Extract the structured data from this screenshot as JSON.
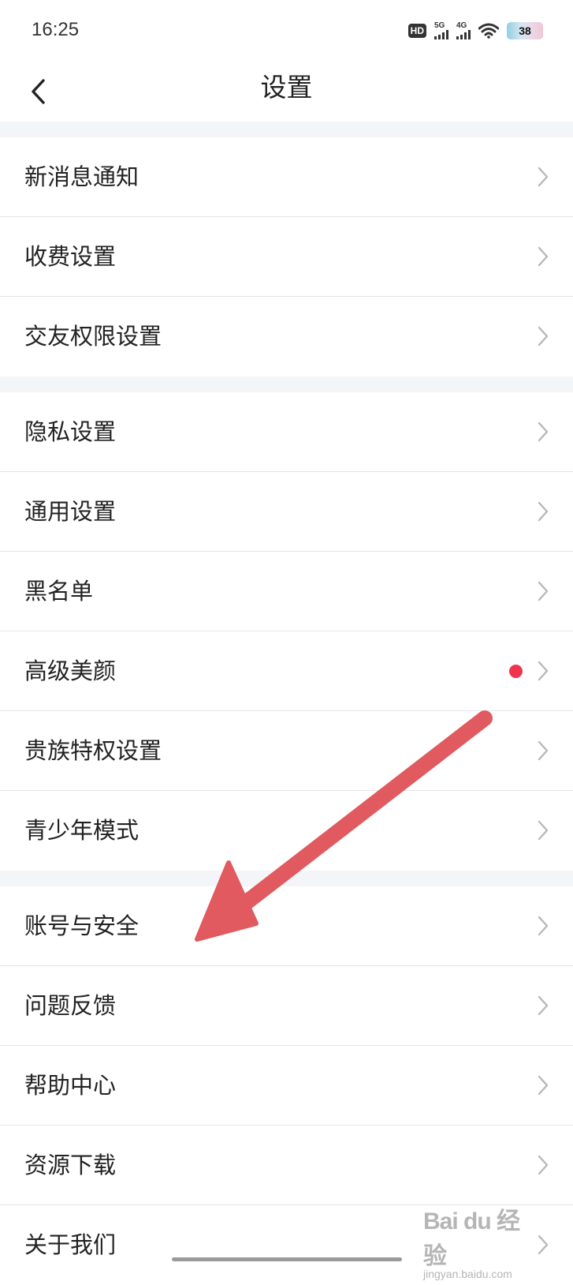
{
  "status_bar": {
    "time": "16:25",
    "hd_label": "HD",
    "sim1_network": "5G",
    "sim2_network": "4G",
    "battery_level": "38"
  },
  "nav": {
    "title": "设置",
    "back_icon": "chevron-left-icon"
  },
  "groups": [
    {
      "items": [
        {
          "label": "新消息通知"
        },
        {
          "label": "收费设置"
        },
        {
          "label": "交友权限设置"
        }
      ]
    },
    {
      "items": [
        {
          "label": "隐私设置"
        },
        {
          "label": "通用设置"
        },
        {
          "label": "黑名单"
        },
        {
          "label": "高级美颜",
          "has_red_dot": true
        },
        {
          "label": "贵族特权设置"
        },
        {
          "label": "青少年模式"
        }
      ]
    },
    {
      "items": [
        {
          "label": "账号与安全"
        },
        {
          "label": "问题反馈"
        },
        {
          "label": "帮助中心"
        },
        {
          "label": "资源下载"
        },
        {
          "label": "关于我们"
        }
      ]
    }
  ],
  "annotation": {
    "arrow_color": "#e05a5f"
  },
  "watermark": {
    "logo": "Bai du 经验",
    "url": "jingyan.baidu.com"
  },
  "colors": {
    "background": "#f4f5f8",
    "row_background": "#ffffff",
    "divider": "#e4e4e8",
    "chevron": "#b8b8bc",
    "red_dot": "#f0344f"
  }
}
